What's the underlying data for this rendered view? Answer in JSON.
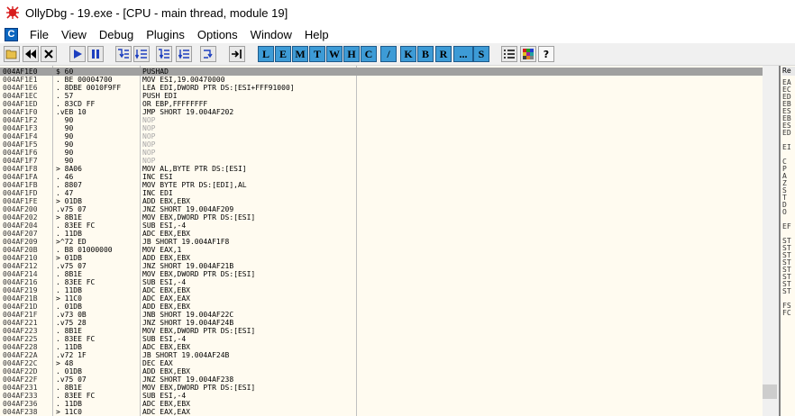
{
  "window": {
    "title": "OllyDbg - 19.exe - [CPU - main thread, module 19]"
  },
  "menu": {
    "badge": "C",
    "items": [
      "File",
      "View",
      "Debug",
      "Plugins",
      "Options",
      "Window",
      "Help"
    ]
  },
  "toolbar": {
    "letters": [
      "L",
      "E",
      "M",
      "T",
      "W",
      "H",
      "C",
      "/",
      "K",
      "B",
      "R",
      "...",
      "S"
    ],
    "help": "?"
  },
  "disasm": {
    "rows": [
      {
        "addr": "004AF1E0",
        "hex": "$ 60",
        "ins": "PUSHAD",
        "nop": false,
        "selected": true
      },
      {
        "addr": "004AF1E1",
        "hex": ". BE 00004700",
        "ins": "MOV ESI,19.00470000",
        "nop": false
      },
      {
        "addr": "004AF1E6",
        "hex": ". 8DBE 0010F9FF",
        "ins": "LEA EDI,DWORD PTR DS:[ESI+FFF91000]",
        "nop": false
      },
      {
        "addr": "004AF1EC",
        "hex": ". 57",
        "ins": "PUSH EDI",
        "nop": false
      },
      {
        "addr": "004AF1ED",
        "hex": ". 83CD FF",
        "ins": "OR EBP,FFFFFFFF",
        "nop": false
      },
      {
        "addr": "004AF1F0",
        "hex": ".vEB 10",
        "ins": "JMP SHORT 19.004AF202",
        "nop": false
      },
      {
        "addr": "004AF1F2",
        "hex": "  90",
        "ins": "NOP",
        "nop": true
      },
      {
        "addr": "004AF1F3",
        "hex": "  90",
        "ins": "NOP",
        "nop": true
      },
      {
        "addr": "004AF1F4",
        "hex": "  90",
        "ins": "NOP",
        "nop": true
      },
      {
        "addr": "004AF1F5",
        "hex": "  90",
        "ins": "NOP",
        "nop": true
      },
      {
        "addr": "004AF1F6",
        "hex": "  90",
        "ins": "NOP",
        "nop": true
      },
      {
        "addr": "004AF1F7",
        "hex": "  90",
        "ins": "NOP",
        "nop": true
      },
      {
        "addr": "004AF1F8",
        "hex": "> 8A06",
        "ins": "MOV AL,BYTE PTR DS:[ESI]",
        "nop": false
      },
      {
        "addr": "004AF1FA",
        "hex": ". 46",
        "ins": "INC ESI",
        "nop": false
      },
      {
        "addr": "004AF1FB",
        "hex": ". 8807",
        "ins": "MOV BYTE PTR DS:[EDI],AL",
        "nop": false
      },
      {
        "addr": "004AF1FD",
        "hex": ". 47",
        "ins": "INC EDI",
        "nop": false
      },
      {
        "addr": "004AF1FE",
        "hex": "> 01DB",
        "ins": "ADD EBX,EBX",
        "nop": false
      },
      {
        "addr": "004AF200",
        "hex": ".v75 07",
        "ins": "JNZ SHORT 19.004AF209",
        "nop": false
      },
      {
        "addr": "004AF202",
        "hex": "> 8B1E",
        "ins": "MOV EBX,DWORD PTR DS:[ESI]",
        "nop": false
      },
      {
        "addr": "004AF204",
        "hex": ". 83EE FC",
        "ins": "SUB ESI,-4",
        "nop": false
      },
      {
        "addr": "004AF207",
        "hex": ". 11DB",
        "ins": "ADC EBX,EBX",
        "nop": false
      },
      {
        "addr": "004AF209",
        "hex": ">^72 ED",
        "ins": "JB SHORT 19.004AF1F8",
        "nop": false
      },
      {
        "addr": "004AF20B",
        "hex": ". B8 01000000",
        "ins": "MOV EAX,1",
        "nop": false
      },
      {
        "addr": "004AF210",
        "hex": "> 01DB",
        "ins": "ADD EBX,EBX",
        "nop": false
      },
      {
        "addr": "004AF212",
        "hex": ".v75 07",
        "ins": "JNZ SHORT 19.004AF21B",
        "nop": false
      },
      {
        "addr": "004AF214",
        "hex": ". 8B1E",
        "ins": "MOV EBX,DWORD PTR DS:[ESI]",
        "nop": false
      },
      {
        "addr": "004AF216",
        "hex": ". 83EE FC",
        "ins": "SUB ESI,-4",
        "nop": false
      },
      {
        "addr": "004AF219",
        "hex": ". 11DB",
        "ins": "ADC EBX,EBX",
        "nop": false
      },
      {
        "addr": "004AF21B",
        "hex": "> 11C0",
        "ins": "ADC EAX,EAX",
        "nop": false
      },
      {
        "addr": "004AF21D",
        "hex": ". 01DB",
        "ins": "ADD EBX,EBX",
        "nop": false
      },
      {
        "addr": "004AF21F",
        "hex": ".v73 0B",
        "ins": "JNB SHORT 19.004AF22C",
        "nop": false
      },
      {
        "addr": "004AF221",
        "hex": ".v75 28",
        "ins": "JNZ SHORT 19.004AF24B",
        "nop": false
      },
      {
        "addr": "004AF223",
        "hex": ". 8B1E",
        "ins": "MOV EBX,DWORD PTR DS:[ESI]",
        "nop": false
      },
      {
        "addr": "004AF225",
        "hex": ". 83EE FC",
        "ins": "SUB ESI,-4",
        "nop": false
      },
      {
        "addr": "004AF228",
        "hex": ". 11DB",
        "ins": "ADC EBX,EBX",
        "nop": false
      },
      {
        "addr": "004AF22A",
        "hex": ".v72 1F",
        "ins": "JB SHORT 19.004AF24B",
        "nop": false
      },
      {
        "addr": "004AF22C",
        "hex": "> 48",
        "ins": "DEC EAX",
        "nop": false
      },
      {
        "addr": "004AF22D",
        "hex": ". 01DB",
        "ins": "ADD EBX,EBX",
        "nop": false
      },
      {
        "addr": "004AF22F",
        "hex": ".v75 07",
        "ins": "JNZ SHORT 19.004AF238",
        "nop": false
      },
      {
        "addr": "004AF231",
        "hex": ". 8B1E",
        "ins": "MOV EBX,DWORD PTR DS:[ESI]",
        "nop": false
      },
      {
        "addr": "004AF233",
        "hex": ". 83EE FC",
        "ins": "SUB ESI,-4",
        "nop": false
      },
      {
        "addr": "004AF236",
        "hex": ". 11DB",
        "ins": "ADC EBX,EBX",
        "nop": false
      },
      {
        "addr": "004AF238",
        "hex": "> 11C0",
        "ins": "ADC EAX,EAX",
        "nop": false
      }
    ]
  },
  "registers": {
    "header": "Re",
    "labels": [
      "EA",
      "EC",
      "ED",
      "EB",
      "ES",
      "EB",
      "ES",
      "ED",
      "",
      "EI",
      "",
      "C",
      "P",
      "A",
      "Z",
      "S",
      "T",
      "D",
      "O",
      "",
      "EF",
      "",
      "ST",
      "ST",
      "ST",
      "ST",
      "ST",
      "ST",
      "ST",
      "ST",
      "",
      "FS",
      "FC"
    ]
  }
}
